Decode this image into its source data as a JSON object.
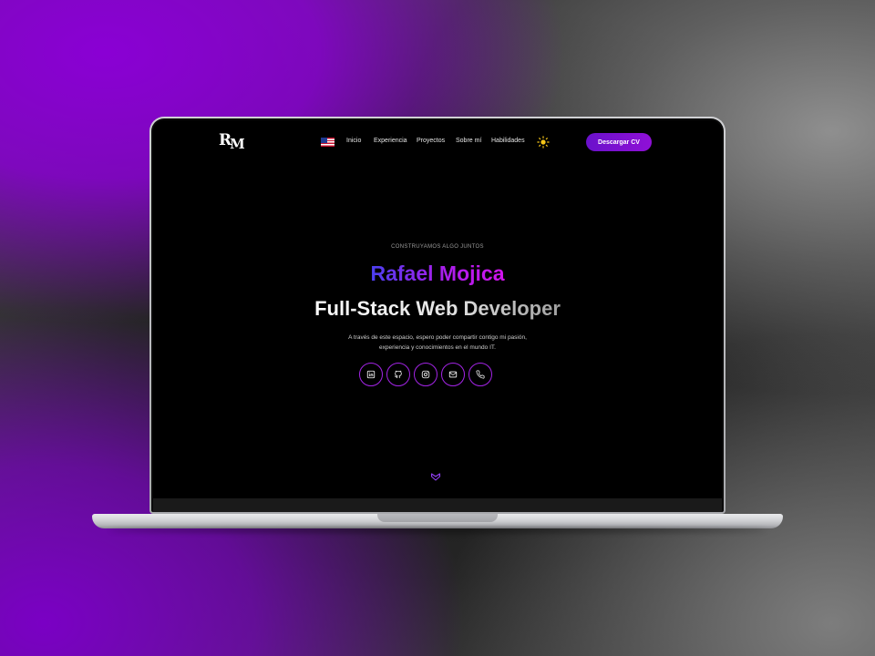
{
  "nav": {
    "logo": "RM",
    "language_flag": "us-flag-icon",
    "links": [
      "Inicio",
      "Experiencia",
      "Proyectos",
      "Sobre mí",
      "Habilidades"
    ],
    "theme_toggle_icon": "sun-icon",
    "cv_button": "Descargar CV"
  },
  "hero": {
    "eyebrow": "CONSTRUYAMOS ALGO JUNTOS",
    "name": "Rafael Mojica",
    "role": "Full-Stack Web Developer",
    "description_line1": "A través de este espacio, espero poder compartir contigo mi pasión,",
    "description_line2": "experiencia y conocimientos en el mundo IT.",
    "socials": [
      "linkedin-icon",
      "github-icon",
      "instagram-icon",
      "mail-icon",
      "phone-icon"
    ],
    "scroll_icon": "chevron-down-icon"
  },
  "colors": {
    "accent_purple": "#8f10d6",
    "name_gradient_start": "#4b3ff0",
    "name_gradient_end": "#d313ee",
    "screen_background": "#000000"
  }
}
